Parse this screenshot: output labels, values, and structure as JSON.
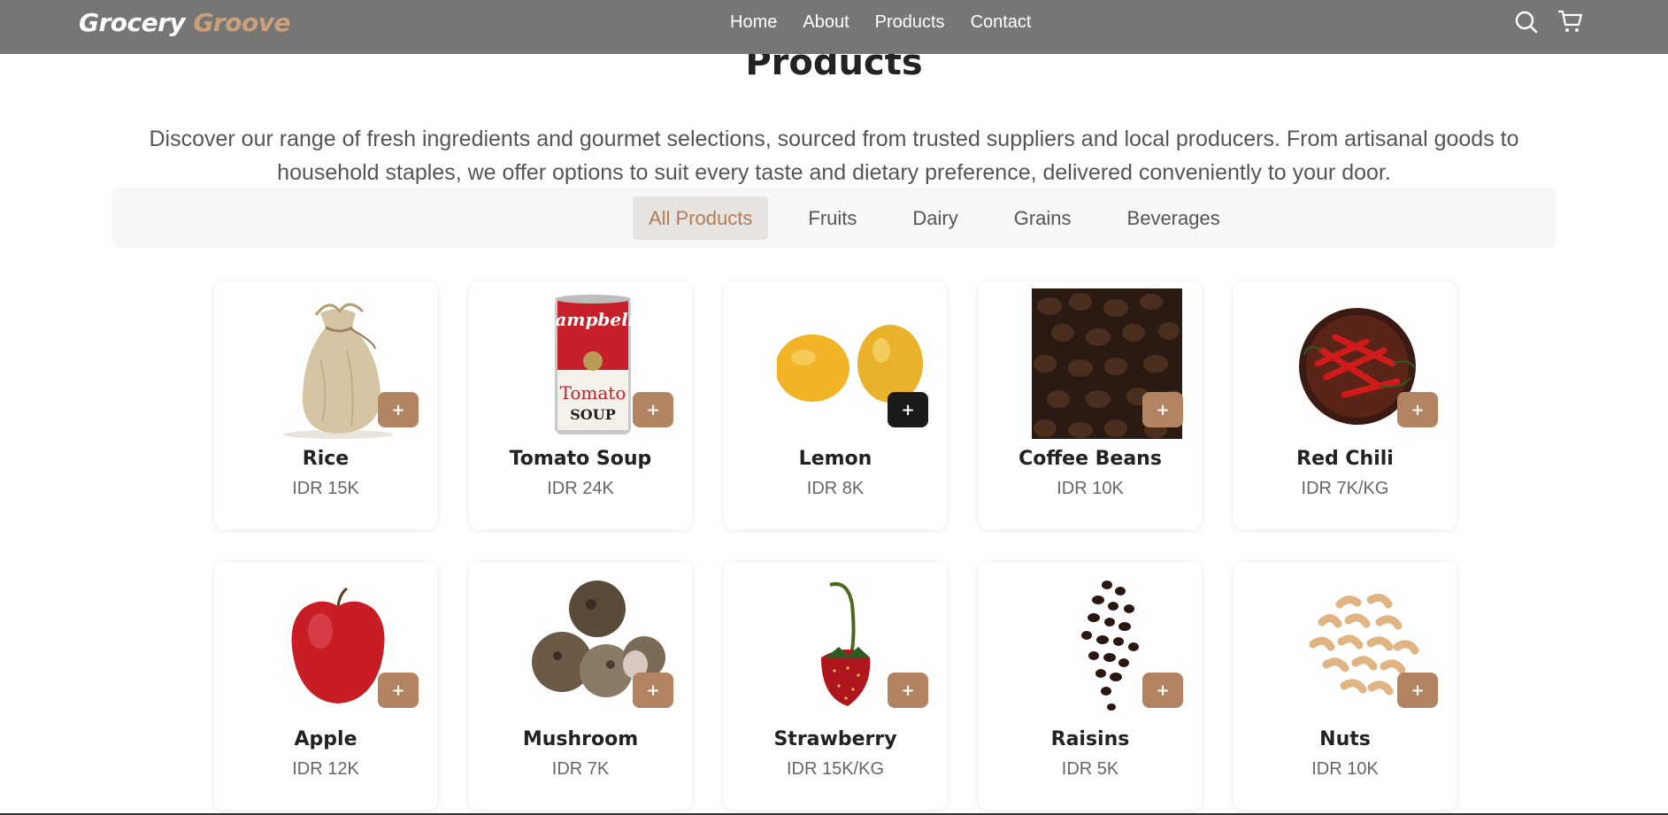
{
  "brand": {
    "word1": "Grocery",
    "word2": "Groove"
  },
  "nav": {
    "items": [
      "Home",
      "About",
      "Products",
      "Contact"
    ]
  },
  "icons": {
    "search": "search-icon",
    "cart": "cart-icon"
  },
  "colors": {
    "accent": "#b38462",
    "topbar": "#767676",
    "active_filter_bg": "#e6e3e1"
  },
  "page": {
    "title": "Products",
    "description": "Discover our range of fresh ingredients and gourmet selections, sourced from trusted suppliers and local producers. From artisanal goods to household staples, we offer options to suit every taste and dietary preference, delivered conveniently to your door."
  },
  "filters": {
    "items": [
      "All Products",
      "Fruits",
      "Dairy",
      "Grains",
      "Beverages"
    ],
    "active": "All Products"
  },
  "products": [
    {
      "name": "Rice",
      "price": "IDR 15K",
      "image": "rice-sack-image",
      "add_label": "+"
    },
    {
      "name": "Tomato Soup",
      "price": "IDR 24K",
      "image": "tomato-soup-can-image",
      "add_label": "+"
    },
    {
      "name": "Lemon",
      "price": "IDR 8K",
      "image": "lemon-image",
      "add_label": "+"
    },
    {
      "name": "Coffee Beans",
      "price": "IDR 10K",
      "image": "coffee-beans-image",
      "add_label": "+"
    },
    {
      "name": "Red Chili",
      "price": "IDR 7K/KG",
      "image": "red-chili-image",
      "add_label": "+"
    },
    {
      "name": "Apple",
      "price": "IDR 12K",
      "image": "apple-image",
      "add_label": "+"
    },
    {
      "name": "Mushroom",
      "price": "IDR 7K",
      "image": "mushroom-image",
      "add_label": "+"
    },
    {
      "name": "Strawberry",
      "price": "IDR 15K/KG",
      "image": "strawberry-image",
      "add_label": "+"
    },
    {
      "name": "Raisins",
      "price": "IDR 5K",
      "image": "raisins-image",
      "add_label": "+"
    },
    {
      "name": "Nuts",
      "price": "IDR 10K",
      "image": "nuts-image",
      "add_label": "+"
    }
  ]
}
